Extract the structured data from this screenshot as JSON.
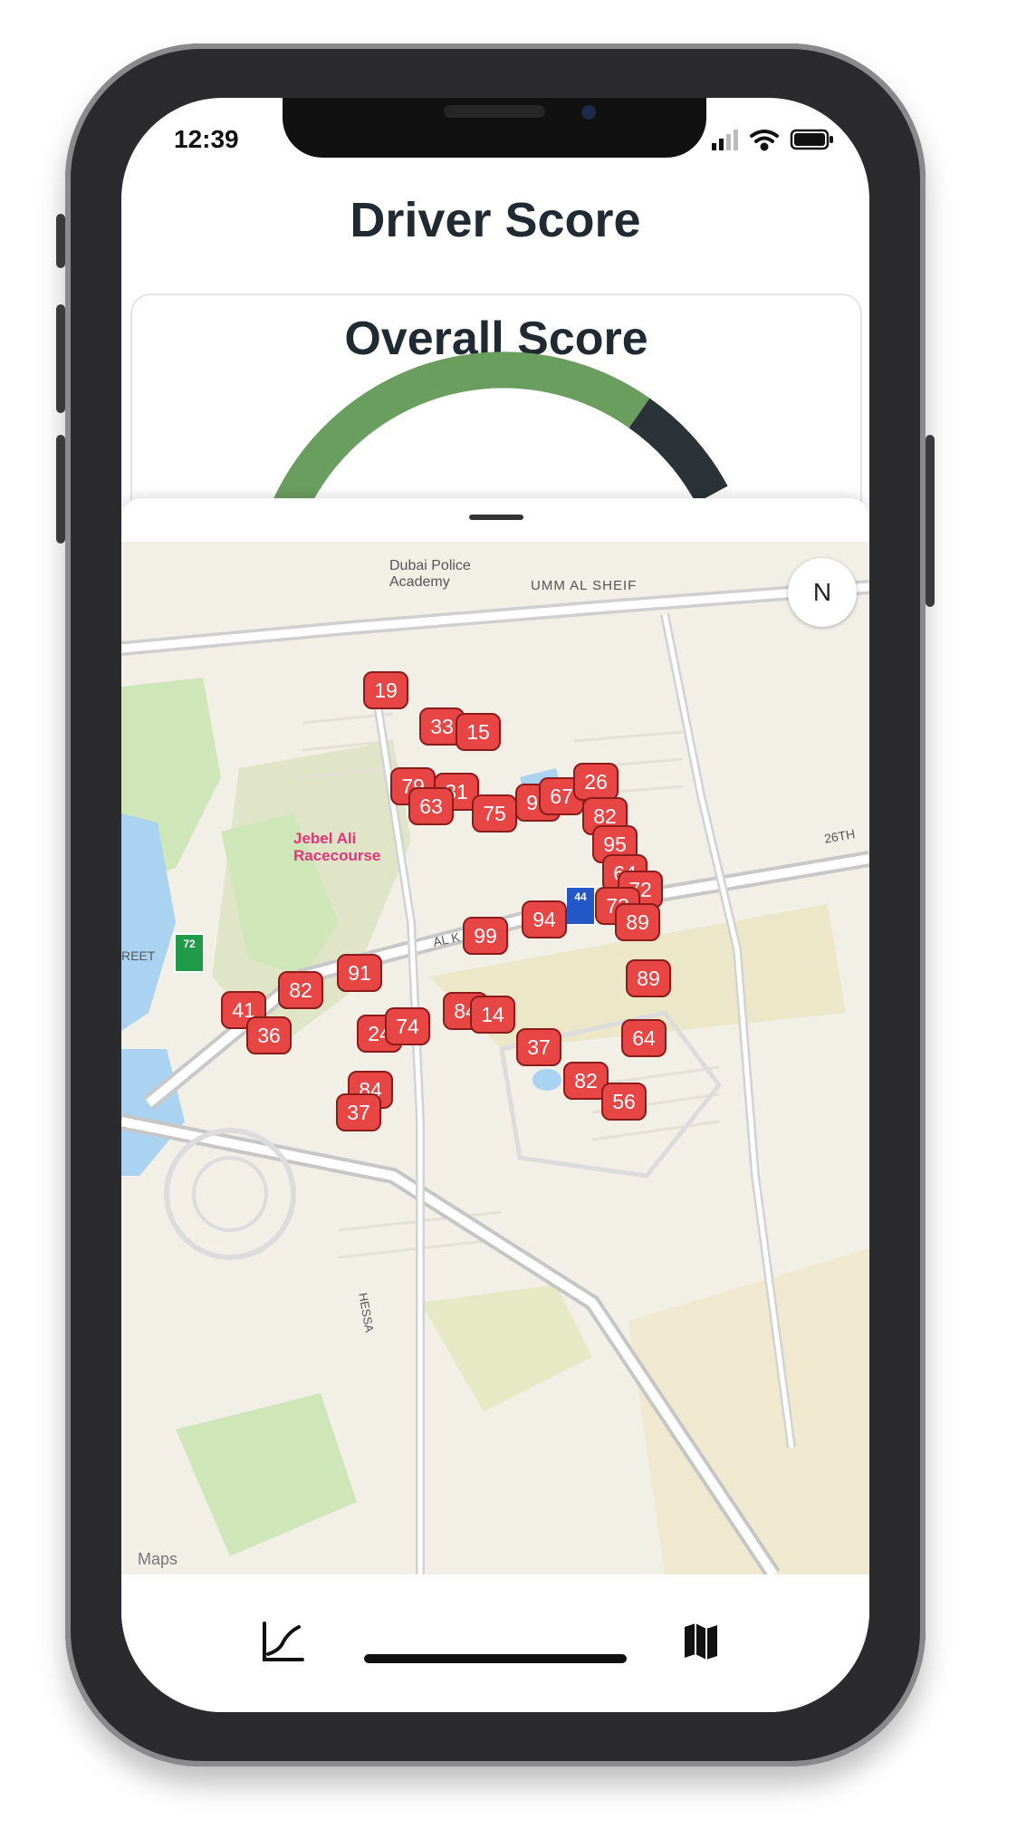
{
  "status_bar": {
    "time": "12:39"
  },
  "header": {
    "title": "Driver Score"
  },
  "score_card": {
    "title": "Overall Score",
    "gauge_colors": {
      "fill": "#6a9e5f",
      "track": "#2c3338"
    }
  },
  "map": {
    "labels": {
      "police": "Dubai Police\nAcademy",
      "umm": "UMM AL SHEIF",
      "racecourse": "Jebel Ali\nRacecourse",
      "street_26": "26TH",
      "street_al": "AL K",
      "reet": "REET",
      "hessa": "HESSA",
      "maps": "Maps"
    },
    "compass": "N",
    "shields": {
      "d72": "72",
      "e44": "44"
    },
    "markers": [
      "19",
      "33",
      "15",
      "79",
      "31",
      "63",
      "75",
      "96",
      "67",
      "26",
      "82",
      "95",
      "64",
      "72",
      "73",
      "99",
      "94",
      "89",
      "89",
      "91",
      "82",
      "41",
      "36",
      "24",
      "74",
      "84",
      "14",
      "37",
      "64",
      "82",
      "56",
      "84",
      "37"
    ]
  },
  "tabs": [
    {
      "name": "score-chart",
      "icon": "line-chart-icon"
    },
    {
      "name": "map",
      "icon": "map-icon"
    }
  ],
  "colors": {
    "marker": "#e84545",
    "text": "#1f2a33"
  }
}
